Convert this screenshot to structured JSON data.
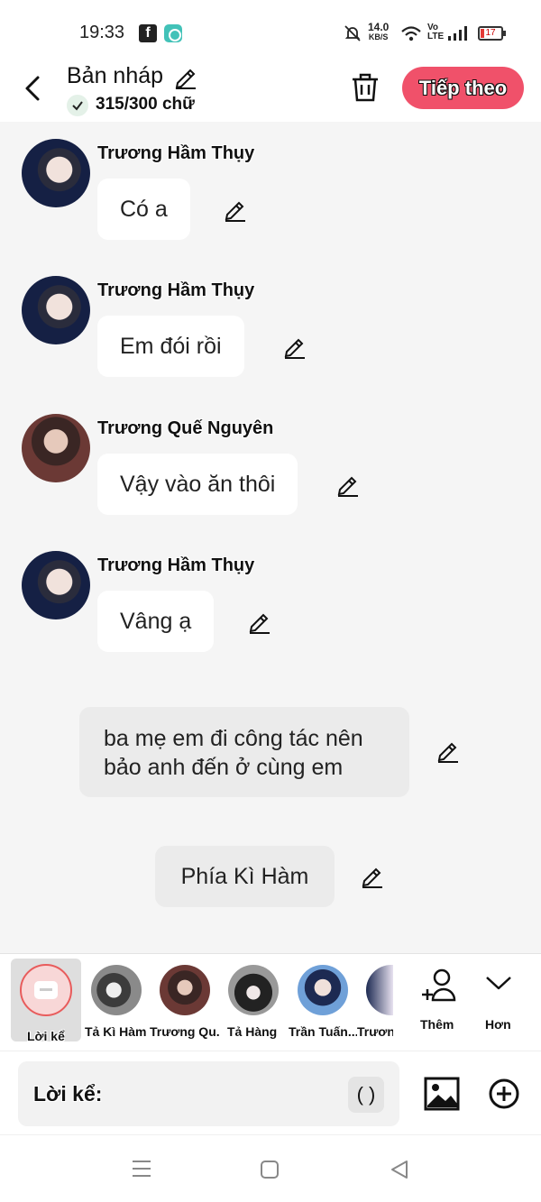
{
  "status_bar": {
    "time": "19:33",
    "speed": "14.0",
    "speed_unit": "KB/S",
    "volte": "Vo LTE",
    "battery": "17"
  },
  "header": {
    "title": "Bản nháp",
    "word_count": "315/300 chữ",
    "next_label": "Tiếp theo",
    "accent": "#f0516a"
  },
  "messages": [
    {
      "type": "character",
      "name": "Trương Hầm Thụy",
      "text": "Có a"
    },
    {
      "type": "character",
      "name": "Trương Hầm Thụy",
      "text": "Em đói rồi"
    },
    {
      "type": "character",
      "name": "Trương Quế Nguyên",
      "text": "Vậy vào ăn thôi"
    },
    {
      "type": "character",
      "name": "Trương Hầm Thụy",
      "text": "Vâng ạ"
    },
    {
      "type": "narration",
      "text_line1": "ba mẹ em đi công tác nên",
      "text_line2": "bảo anh đến ở cùng em"
    },
    {
      "type": "narration",
      "text": "Phía Kì Hàm"
    }
  ],
  "character_bar": {
    "items": [
      {
        "label": "Lời kể"
      },
      {
        "label": "Tả Kì Hàm"
      },
      {
        "label": "Trương Qu..."
      },
      {
        "label": "Tả Hàng"
      },
      {
        "label": "Trần Tuấn..."
      },
      {
        "label": "Trươn"
      }
    ],
    "add_label": "Thêm",
    "more_label": "Hơn"
  },
  "composer": {
    "label": "Lời kể:",
    "paren": "( )"
  }
}
